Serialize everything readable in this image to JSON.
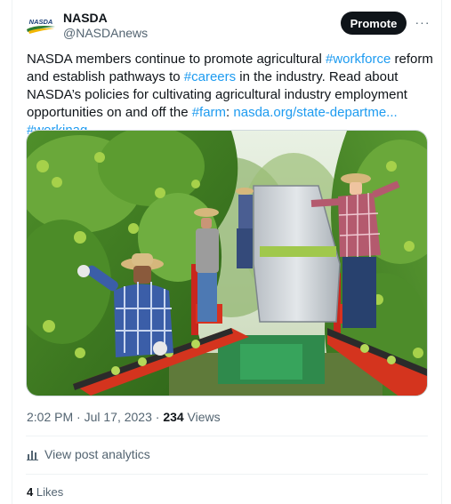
{
  "header": {
    "display_name": "NASDA",
    "handle": "@NASDAnews",
    "avatar_text": "NASDA",
    "promote_label": "Promote",
    "more_label": "···"
  },
  "tweet": {
    "segments": [
      {
        "text": "NASDA members continue to promote agricultural ",
        "link": false
      },
      {
        "text": "#workforce",
        "link": true
      },
      {
        "text": " reform and establish pathways to ",
        "link": false
      },
      {
        "text": "#careers",
        "link": true
      },
      {
        "text": " in the industry. Read about NASDA’s policies for cultivating agricultural industry employment opportunities on and off the ",
        "link": false
      },
      {
        "text": "#farm",
        "link": true
      },
      {
        "text": ": ",
        "link": false
      },
      {
        "text": "nasda.org/state-departme...",
        "link": true
      },
      {
        "text": " ",
        "link": false
      },
      {
        "text": "#workinag",
        "link": true
      }
    ]
  },
  "meta": {
    "timestamp": "2:02 PM · Jul 17, 2023 · ",
    "views_count": "234",
    "views_label": " Views"
  },
  "analytics": {
    "label": "View post analytics",
    "icon": "bar-chart-icon"
  },
  "likes": {
    "count": "4",
    "label": " Likes"
  },
  "colors": {
    "link": "#1d9bf0",
    "text": "#0f1419",
    "secondary": "#536471",
    "promote_bg": "#0f1419"
  }
}
